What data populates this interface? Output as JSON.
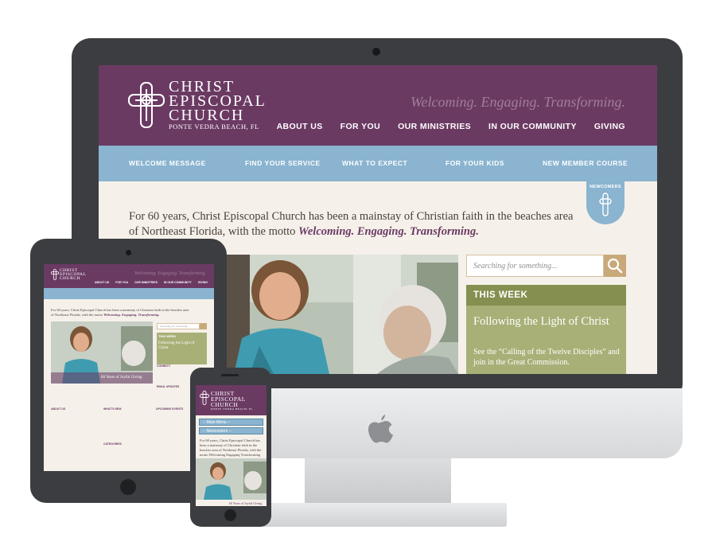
{
  "desktop": {
    "logo": {
      "name_line1": "CHRIST",
      "name_line2": "EPISCOPAL",
      "name_line3": "CHURCH",
      "location": "PONTE VEDRA BEACH, FL"
    },
    "tagline": "Welcoming. Engaging. Transforming.",
    "main_nav": [
      "ABOUT US",
      "FOR YOU",
      "OUR MINISTRIES",
      "IN OUR COMMUNITY",
      "GIVING"
    ],
    "sub_nav": [
      "WELCOME MESSAGE",
      "FIND YOUR SERVICE",
      "WHAT TO EXPECT",
      "FOR YOUR KIDS",
      "NEW MEMBER COURSE"
    ],
    "newcomers_label": "NEWCOMERS",
    "intro_text": "For 60 years, Christ Episcopal Church has been a mainstay of Christian faith in the beaches area of Northeast Florida, with the motto",
    "intro_motto": "Welcoming. Engaging. Transforming.",
    "search_placeholder": "Searching for something...",
    "this_week": {
      "label": "THIS WEEK",
      "title": "Following the Light of Christ",
      "description": "See the “Calling of the Twelve Disciples” and join in the Great Commission."
    }
  },
  "tablet": {
    "logo": "CHRIST EPISCOPAL CHURCH",
    "tagline": "Welcoming. Engaging. Transforming.",
    "nav": [
      "ABOUT US",
      "FOR YOU",
      "OUR MINISTRIES",
      "IN OUR COMMUNITY",
      "GIVING"
    ],
    "intro_text": "For 60 years, Christ Episcopal Church has been a mainstay of Christian faith in the beaches area of Northeast Florida, with the motto",
    "intro_motto": "Welcoming. Engaging. Transforming.",
    "search_placeholder": "Searching for something...",
    "this_week_label": "THIS WEEK",
    "this_week_title": "Following the Light of Christ",
    "joyful": "60 Years of Joyful Giving",
    "about_label": "ABOUT US",
    "whats_new_label": "WHAT'S NEW",
    "upcoming_label": "UPCOMING EVENTS",
    "categories_label": "CATEGORIES",
    "connect_label": "CONNECT",
    "email_label": "EMAIL UPDATES"
  },
  "phone": {
    "logo_line1": "CHRIST",
    "logo_line2": "EPISCOPAL",
    "logo_line3": "CHURCH",
    "logo_location": "PONTE VEDRA BEACH, FL",
    "main_menu": "-- Main Menu --",
    "newcomers_menu": "-- Newcomers --",
    "intro_text": "For 60 years, Christ Episcopal Church has been a mainstay of Christian faith in the beaches area of Northeast Florida, with the motto Welcoming Engaging Transforming",
    "joyful": "60 Years of Joyful Giving"
  },
  "colors": {
    "header_purple": "#6b3a63",
    "subnav_blue": "#8ab4d0",
    "this_week_green": "#a8b077",
    "search_tan": "#c9a97a",
    "page_cream": "#f5f1ea"
  },
  "icons": {
    "logo": "cross-logo-icon",
    "search": "search-icon",
    "newcomers": "newcomers-cross-icon",
    "device_brand": "apple-logo-icon"
  }
}
